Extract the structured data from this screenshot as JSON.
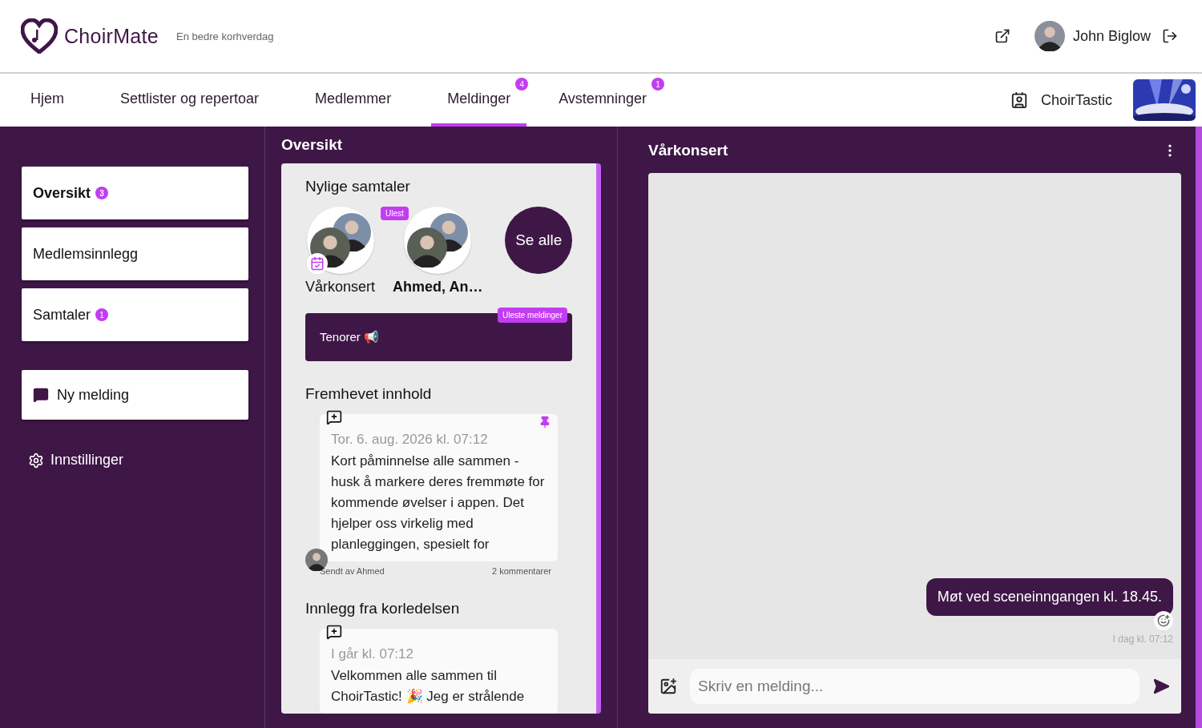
{
  "header": {
    "logo_text": "ChoirMate",
    "tagline": "En bedre korhverdag",
    "user_name": "John Biglow"
  },
  "nav": {
    "tabs": [
      {
        "label": "Hjem",
        "selected": false
      },
      {
        "label": "Settlister og repertoar",
        "selected": false
      },
      {
        "label": "Medlemmer",
        "selected": false
      },
      {
        "label": "Meldinger",
        "selected": true,
        "badge": "4"
      },
      {
        "label": "Avstemninger",
        "selected": false,
        "badge": "1"
      }
    ],
    "choir_name": "ChoirTastic"
  },
  "sidebar": {
    "items": [
      {
        "label": "Oversikt",
        "selected": true,
        "badge": "3"
      },
      {
        "label": "Medlemsinnlegg",
        "selected": false
      },
      {
        "label": "Samtaler",
        "selected": false,
        "badge": "1"
      }
    ],
    "new_message": "Ny melding",
    "settings": "Innstillinger"
  },
  "overview": {
    "title": "Oversikt",
    "recent_title": "Nylige samtaler",
    "conversations": [
      {
        "name": "Vårkonsert",
        "unread": false,
        "kind": "event"
      },
      {
        "name": "Ahmed, An…",
        "unread": true,
        "badge": "Ulest",
        "kind": "people"
      }
    ],
    "see_all": "Se alle",
    "group": {
      "name": "Tenorer 📢",
      "badge": "Uleste meldinger"
    },
    "featured_title": "Fremhevet innhold",
    "featured_post": {
      "date": "Tor. 6. aug. 2026 kl. 07:12",
      "text": "Kort påminnelse alle sammen - husk å markere deres fremmøte for kommende øvelser i appen. Det hjelper oss virkelig med planleggingen, spesielt for",
      "pinned": true,
      "author": "Sendt av Ahmed",
      "comments": "2 kommentarer"
    },
    "leaders_title": "Innlegg fra korledelsen",
    "leaders_post": {
      "date": "I går kl. 07:12",
      "text": "Velkommen alle sammen til ChoirTastic! 🎉 Jeg er strålende"
    }
  },
  "chat": {
    "title": "Vårkonsert",
    "messages": [
      {
        "text": "Møt ved sceneinngangen kl. 18.45.",
        "time": "I dag kl. 07:12"
      }
    ],
    "input_placeholder": "Skriv en melding..."
  }
}
